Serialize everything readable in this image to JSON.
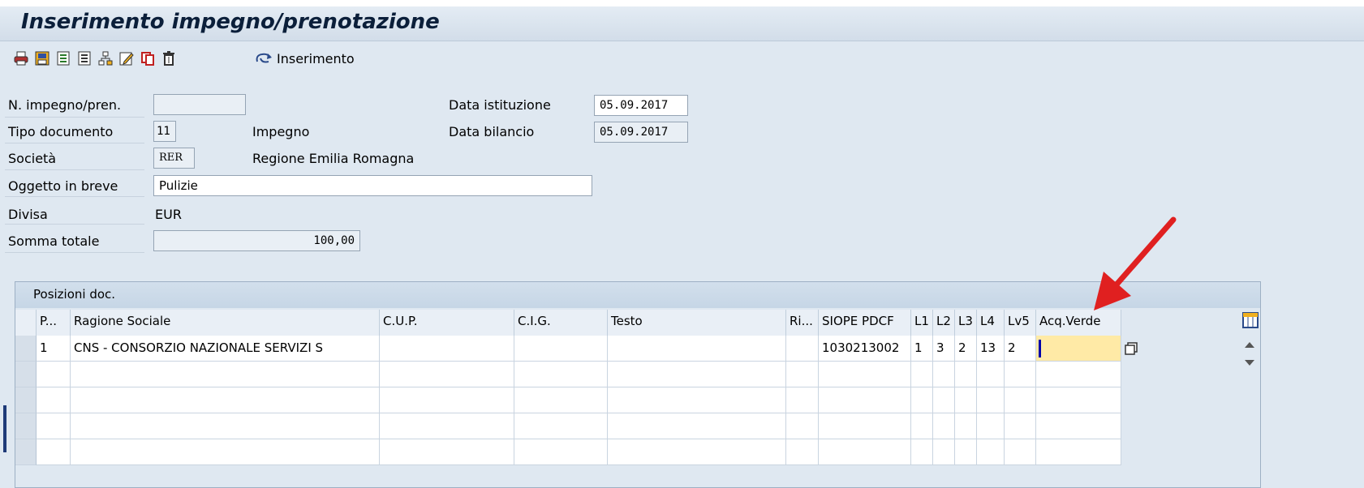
{
  "title": "Inserimento impegno/prenotazione",
  "toolbar": {
    "icons": [
      "print-icon",
      "save-icon",
      "list-icon",
      "list-alt-icon",
      "hierarchy-icon",
      "edit-icon",
      "copy-icon",
      "delete-icon"
    ],
    "insert_label": "Inserimento"
  },
  "header": {
    "n_impegno_label": "N. impegno/pren.",
    "n_impegno_value": "",
    "tipo_doc_label": "Tipo documento",
    "tipo_doc_value": "11",
    "tipo_doc_desc": "Impegno",
    "societa_label": "Società",
    "societa_value": "RER",
    "societa_desc": "Regione Emilia Romagna",
    "oggetto_label": "Oggetto in breve",
    "oggetto_value": "Pulizie",
    "divisa_label": "Divisa",
    "divisa_value": "EUR",
    "somma_label": "Somma totale",
    "somma_value": "100,00",
    "data_ist_label": "Data istituzione",
    "data_ist_value": "05.09.2017",
    "data_bil_label": "Data bilancio",
    "data_bil_value": "05.09.2017"
  },
  "table": {
    "title": "Posizioni doc.",
    "headers": [
      "P...",
      "Ragione Sociale",
      "C.U.P.",
      "C.I.G.",
      "Testo",
      "Ri...",
      "SIOPE PDCF",
      "L1",
      "L2",
      "L3",
      "L4",
      "Lv5",
      "Acq.Verde"
    ],
    "rows": [
      [
        "1",
        "CNS - CONSORZIO NAZIONALE SERVIZI S",
        "",
        "",
        "",
        "",
        "1030213002",
        "1",
        "3",
        "2",
        "13",
        "2",
        ""
      ],
      [
        "",
        "",
        "",
        "",
        "",
        "",
        "",
        "",
        "",
        "",
        "",
        "",
        ""
      ],
      [
        "",
        "",
        "",
        "",
        "",
        "",
        "",
        "",
        "",
        "",
        "",
        "",
        ""
      ],
      [
        "",
        "",
        "",
        "",
        "",
        "",
        "",
        "",
        "",
        "",
        "",
        "",
        ""
      ],
      [
        "",
        "",
        "",
        "",
        "",
        "",
        "",
        "",
        "",
        "",
        "",
        "",
        ""
      ]
    ]
  },
  "colors": {
    "background": "#dfe8f1",
    "highlight_cell": "#ffeaa6",
    "annotation_arrow": "#e02020"
  }
}
